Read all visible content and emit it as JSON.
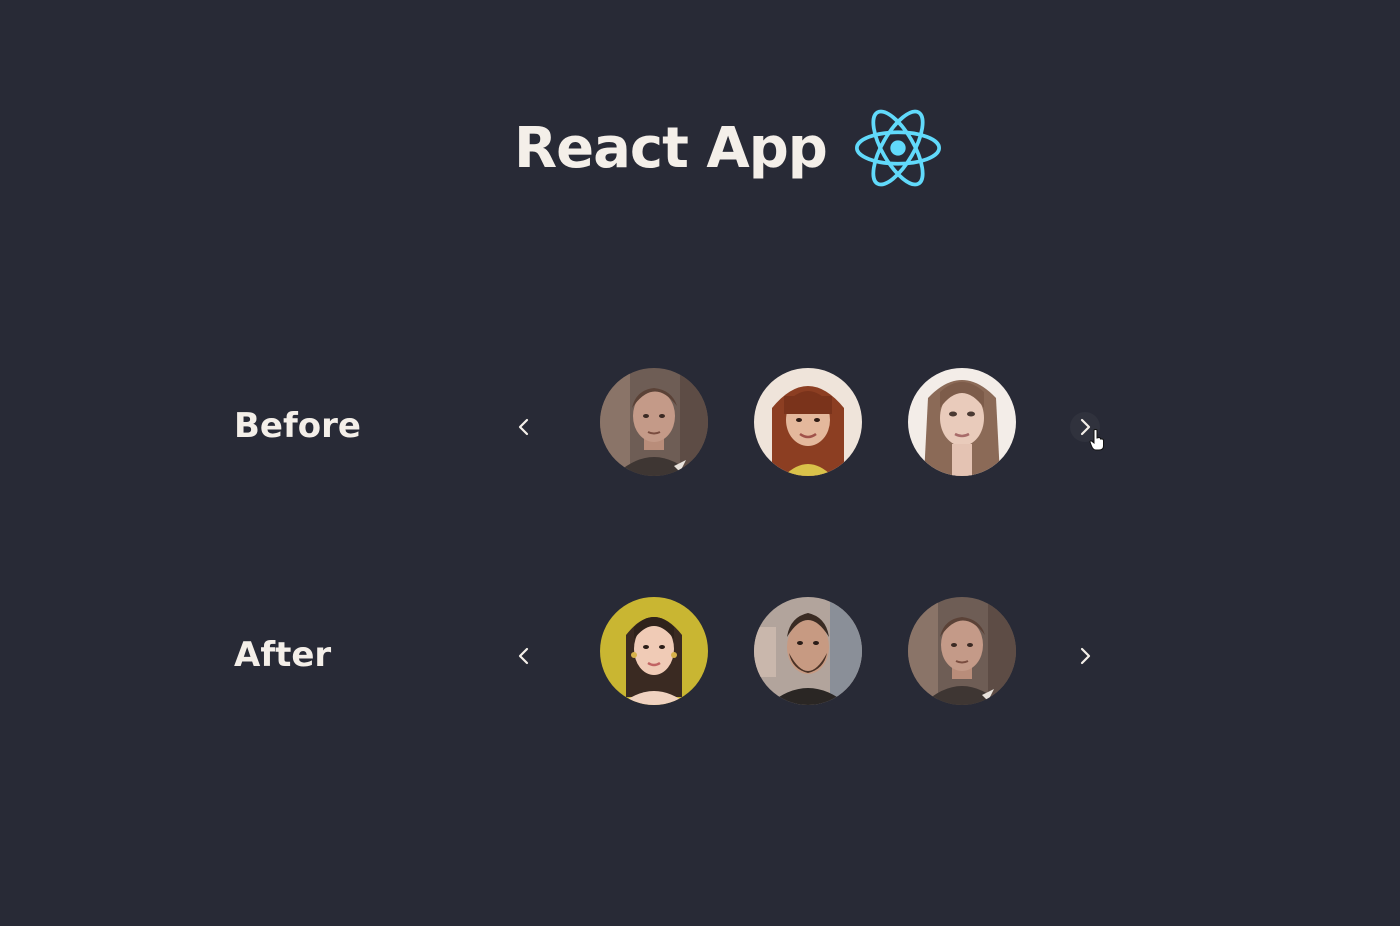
{
  "header": {
    "title": "React App",
    "logo_icon": "react-atom-icon",
    "logo_color": "#61dafb"
  },
  "rows": [
    {
      "label": "Before",
      "prev_icon": "chevron-left-icon",
      "next_icon": "chevron-right-icon",
      "avatars": [
        "man-dark-hair",
        "woman-bangs-red-hair",
        "woman-long-hair"
      ]
    },
    {
      "label": "After",
      "prev_icon": "chevron-left-icon",
      "next_icon": "chevron-right-icon",
      "avatars": [
        "woman-yellow-background",
        "man-beard",
        "man-dark-hair"
      ]
    }
  ],
  "colors": {
    "background": "#282a36",
    "text": "#f4efe9"
  }
}
